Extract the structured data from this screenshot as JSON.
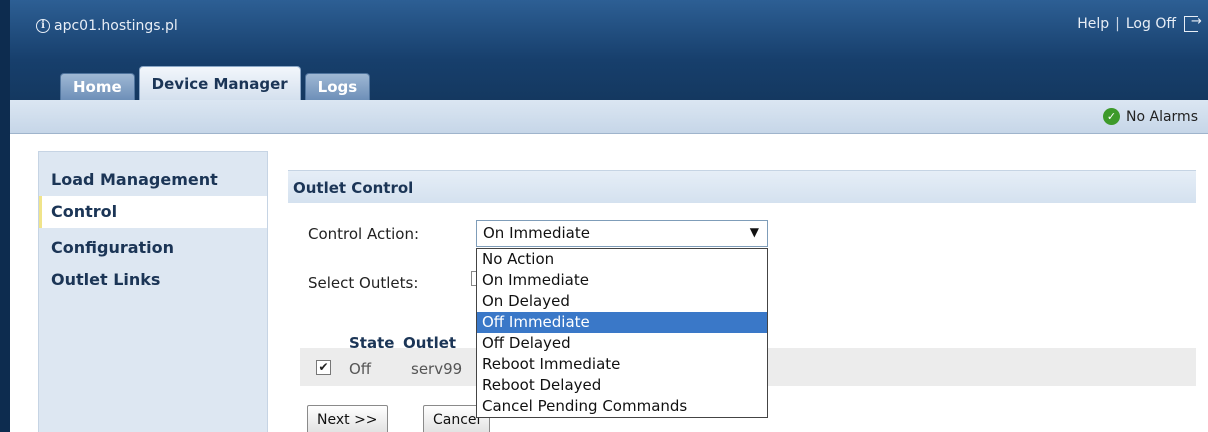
{
  "header": {
    "host": "apc01.hostings.pl",
    "help_label": "Help",
    "separator": "|",
    "logoff_label": "Log Off"
  },
  "tabs": [
    {
      "label": "Home",
      "active": false
    },
    {
      "label": "Device Manager",
      "active": true
    },
    {
      "label": "Logs",
      "active": false
    }
  ],
  "status": {
    "alarms_label": "No Alarms"
  },
  "sidebar": {
    "items": [
      {
        "label": "Load Management",
        "active": false
      },
      {
        "label": "Control",
        "active": true
      },
      {
        "label": "Configuration",
        "active": false
      },
      {
        "label": "Outlet Links",
        "active": false
      }
    ]
  },
  "main": {
    "section_title": "Outlet Control",
    "control_action_label": "Control Action:",
    "select_outlets_label": "Select Outlets:",
    "control_action": {
      "selected": "On Immediate",
      "highlighted": "Off Immediate",
      "options": [
        "No Action",
        "On Immediate",
        "On Delayed",
        "Off Immediate",
        "Off Delayed",
        "Reboot Immediate",
        "Reboot Delayed",
        "Cancel Pending Commands"
      ]
    },
    "table": {
      "headers": {
        "state": "State",
        "outlet": "Outlet"
      },
      "rows": [
        {
          "checked": true,
          "state": "Off",
          "outlet": "serv99"
        }
      ]
    },
    "buttons": {
      "next": "Next >>",
      "cancel": "Cancel"
    }
  }
}
